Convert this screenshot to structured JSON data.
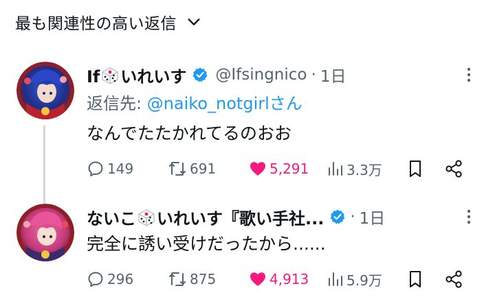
{
  "sort": {
    "label": "最も関連性の高い返信",
    "icon": "chevron-down-icon"
  },
  "colors": {
    "like": "#f91880",
    "link": "#1d9bf0",
    "muted": "#536471",
    "verified": "#1d9bf0",
    "line": "#cfd9de"
  },
  "tweets": [
    {
      "name_pre": "If",
      "name_post": "いれいす",
      "handle": "@Ifsingnico",
      "dot": "·",
      "time": "1日",
      "reply_label": "返信先: ",
      "reply_mention": "@naiko_notgirl",
      "reply_suffix": "さん",
      "text": "なんでたたかれてるのおお",
      "replies": "149",
      "retweets": "691",
      "likes": "5,291",
      "views": "3.3万"
    },
    {
      "name_pre": "ないこ",
      "name_post": "いれいす『歌い手社...",
      "dot": "·",
      "time": "1日",
      "text": "完全に誘い受けだったから......",
      "replies": "296",
      "retweets": "875",
      "likes": "4,913",
      "views": "5.9万"
    }
  ]
}
